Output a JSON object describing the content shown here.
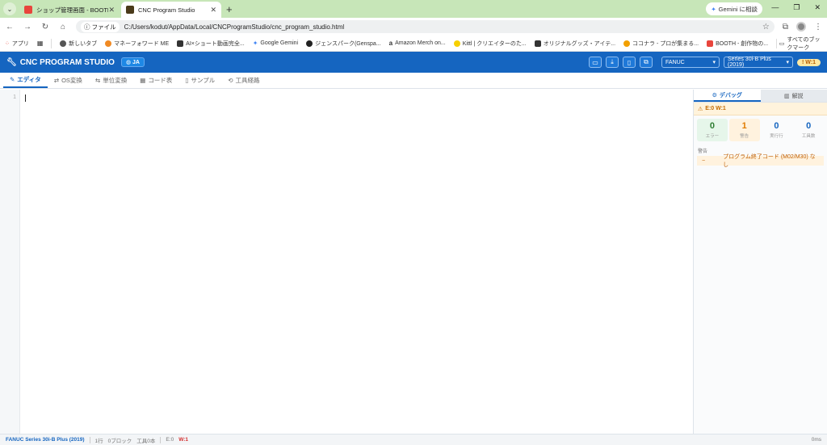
{
  "browser": {
    "tabs": [
      {
        "title": "ショップ管理画面 - BOOTH",
        "favicon_color": "#e8453c",
        "active": false
      },
      {
        "title": "CNC Program Studio",
        "favicon_color": "#4a3a1a",
        "active": true
      }
    ],
    "new_tab": "+",
    "gemini_label": "Gemini に相談",
    "file_chip": "ファイル",
    "url": "C:/Users/kodut/AppData/Local/CNCProgramStudio/cnc_program_studio.html",
    "bookmarks": [
      {
        "label": "アプリ",
        "color": "#e94235"
      },
      {
        "label": "新しいタブ",
        "color": "#555555"
      },
      {
        "label": "マネーフォワード ME",
        "color": "#f08a24"
      },
      {
        "label": "AI×ショート動画完全...",
        "color": "#333333"
      },
      {
        "label": "Google Gemini",
        "color": "#4285f4"
      },
      {
        "label": "ジェンスパーク(Genspa...",
        "color": "#222222"
      },
      {
        "label": "Amazon Merch on...",
        "color": "#222222"
      },
      {
        "label": "Kittl | クリエイターのた...",
        "color": "#f7d000"
      },
      {
        "label": "オリジナルグッズ・アイテ...",
        "color": "#333333"
      },
      {
        "label": "ココナラ - プロが集まる...",
        "color": "#f2a000"
      },
      {
        "label": "BOOTH - 創作物の...",
        "color": "#e8453c"
      }
    ],
    "all_bookmarks": "すべてのブックマーク"
  },
  "app": {
    "title": "CNC PROGRAM STUDIO",
    "lang": "JA",
    "controller": "FANUC",
    "series": "Series 30i-B Plus (2019)",
    "warn_badge": "! W:1"
  },
  "toolbar": {
    "tabs": [
      {
        "label": "エディタ",
        "icon": "pencil-icon",
        "glyph": "✎",
        "active": true
      },
      {
        "label": "OS変換",
        "icon": "convert-icon",
        "glyph": "⇄",
        "active": false
      },
      {
        "label": "単位変換",
        "icon": "ruler-icon",
        "glyph": "⇆",
        "active": false
      },
      {
        "label": "コード表",
        "icon": "table-icon",
        "glyph": "▦",
        "active": false
      },
      {
        "label": "サンプル",
        "icon": "document-icon",
        "glyph": "▯",
        "active": false
      },
      {
        "label": "工具経路",
        "icon": "path-icon",
        "glyph": "⟲",
        "active": false
      }
    ]
  },
  "editor": {
    "line_number": "1"
  },
  "panel": {
    "debug_tab": "デバッグ",
    "explain_tab": "解説",
    "status": "E:0 W:1",
    "stats": [
      {
        "value": "0",
        "label": "エラー",
        "kind": "err"
      },
      {
        "value": "1",
        "label": "警告",
        "kind": "wrn"
      },
      {
        "value": "0",
        "label": "実行行",
        "kind": "exe"
      },
      {
        "value": "0",
        "label": "工具数",
        "kind": "tool"
      }
    ],
    "section_label": "警告",
    "issue_line": "−",
    "issue_text": "プログラム終了コード (M02/M30) なし"
  },
  "footer": {
    "series": "FANUC Series 30i-B Plus (2019)",
    "lines": "1行",
    "blocks": "0ブロック",
    "tools": "工具0本",
    "errors": "E:0",
    "warnings": "W:1",
    "time": "0ms"
  }
}
